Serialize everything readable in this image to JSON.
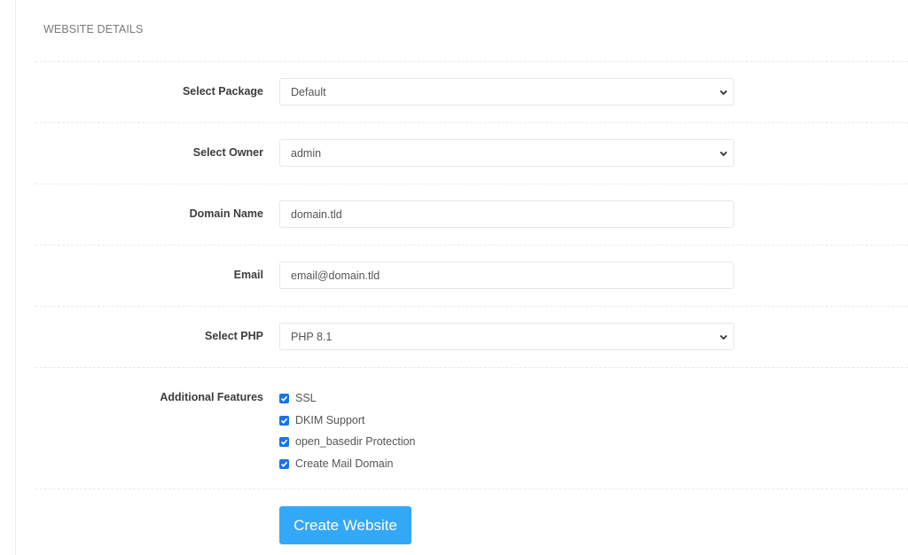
{
  "panel": {
    "title": "WEBSITE DETAILS"
  },
  "form": {
    "package": {
      "label": "Select Package",
      "value": "Default"
    },
    "owner": {
      "label": "Select Owner",
      "value": "admin"
    },
    "domain": {
      "label": "Domain Name",
      "value": "domain.tld"
    },
    "email": {
      "label": "Email",
      "value": "email@domain.tld"
    },
    "php": {
      "label": "Select PHP",
      "value": "PHP 8.1"
    },
    "features": {
      "label": "Additional Features",
      "items": [
        {
          "label": "SSL",
          "checked": true
        },
        {
          "label": "DKIM Support",
          "checked": true
        },
        {
          "label": "open_basedir Protection",
          "checked": true
        },
        {
          "label": "Create Mail Domain",
          "checked": true
        }
      ]
    },
    "submit_label": "Create Website"
  },
  "colors": {
    "accent": "#33a8f6",
    "checkbox": "#1a73e8"
  }
}
